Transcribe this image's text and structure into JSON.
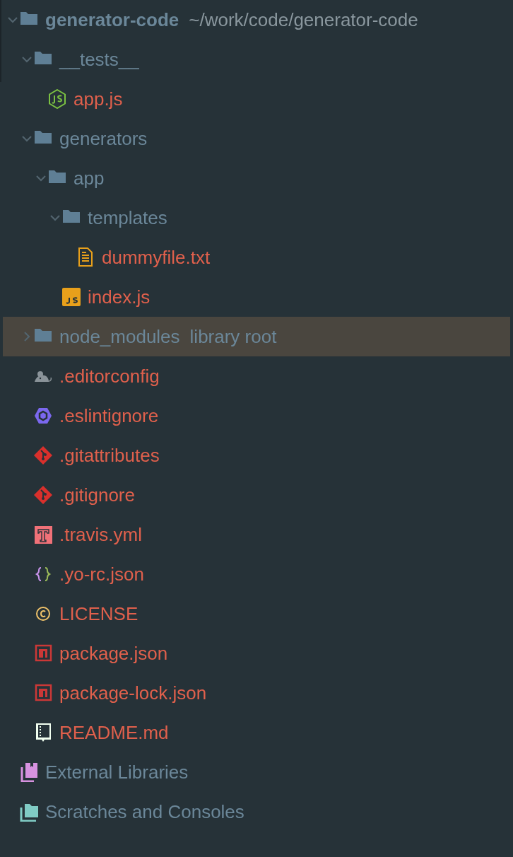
{
  "tree": [
    {
      "kind": "folder",
      "name": "generator-code",
      "path": "~/work/code/generator-code",
      "expanded": true,
      "selected": false,
      "children": [
        {
          "kind": "folder",
          "name": "__tests__",
          "expanded": true,
          "selected": false,
          "children": [
            {
              "kind": "nodejs",
              "name": "app.js",
              "selected": false
            }
          ]
        },
        {
          "kind": "folder",
          "name": "generators",
          "expanded": true,
          "selected": false,
          "children": [
            {
              "kind": "folder",
              "name": "app",
              "expanded": true,
              "selected": false,
              "children": [
                {
                  "kind": "folder",
                  "name": "templates",
                  "expanded": true,
                  "selected": false,
                  "children": [
                    {
                      "kind": "text",
                      "name": "dummyfile.txt",
                      "selected": false
                    }
                  ]
                },
                {
                  "kind": "js",
                  "name": "index.js",
                  "selected": false
                }
              ]
            }
          ]
        },
        {
          "kind": "folder",
          "name": "node_modules",
          "note": "library root",
          "expanded": false,
          "selected": true
        },
        {
          "kind": "mouse",
          "name": ".editorconfig",
          "selected": false
        },
        {
          "kind": "eslint",
          "name": ".eslintignore",
          "selected": false
        },
        {
          "kind": "git",
          "name": ".gitattributes",
          "selected": false
        },
        {
          "kind": "git",
          "name": ".gitignore",
          "selected": false
        },
        {
          "kind": "travis",
          "name": ".travis.yml",
          "selected": false
        },
        {
          "kind": "json",
          "name": ".yo-rc.json",
          "selected": false
        },
        {
          "kind": "license",
          "name": "LICENSE",
          "selected": false
        },
        {
          "kind": "npm",
          "name": "package.json",
          "selected": false
        },
        {
          "kind": "npm",
          "name": "package-lock.json",
          "selected": false
        },
        {
          "kind": "readme",
          "name": "README.md",
          "selected": false
        }
      ]
    },
    {
      "kind": "libraries",
      "name": "External Libraries",
      "selected": false
    },
    {
      "kind": "scratches",
      "name": "Scratches and Consoles",
      "selected": false
    }
  ]
}
